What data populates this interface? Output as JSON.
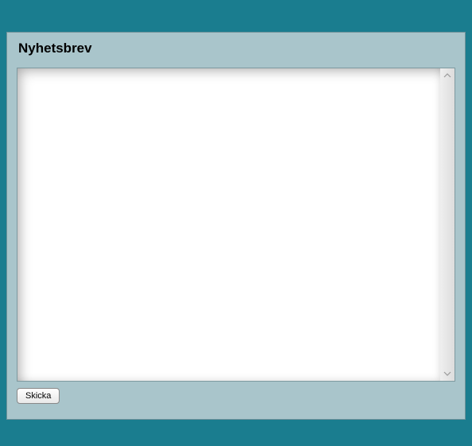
{
  "panel": {
    "title": "Nyhetsbrev"
  },
  "form": {
    "message_value": "",
    "submit_label": "Skicka"
  }
}
